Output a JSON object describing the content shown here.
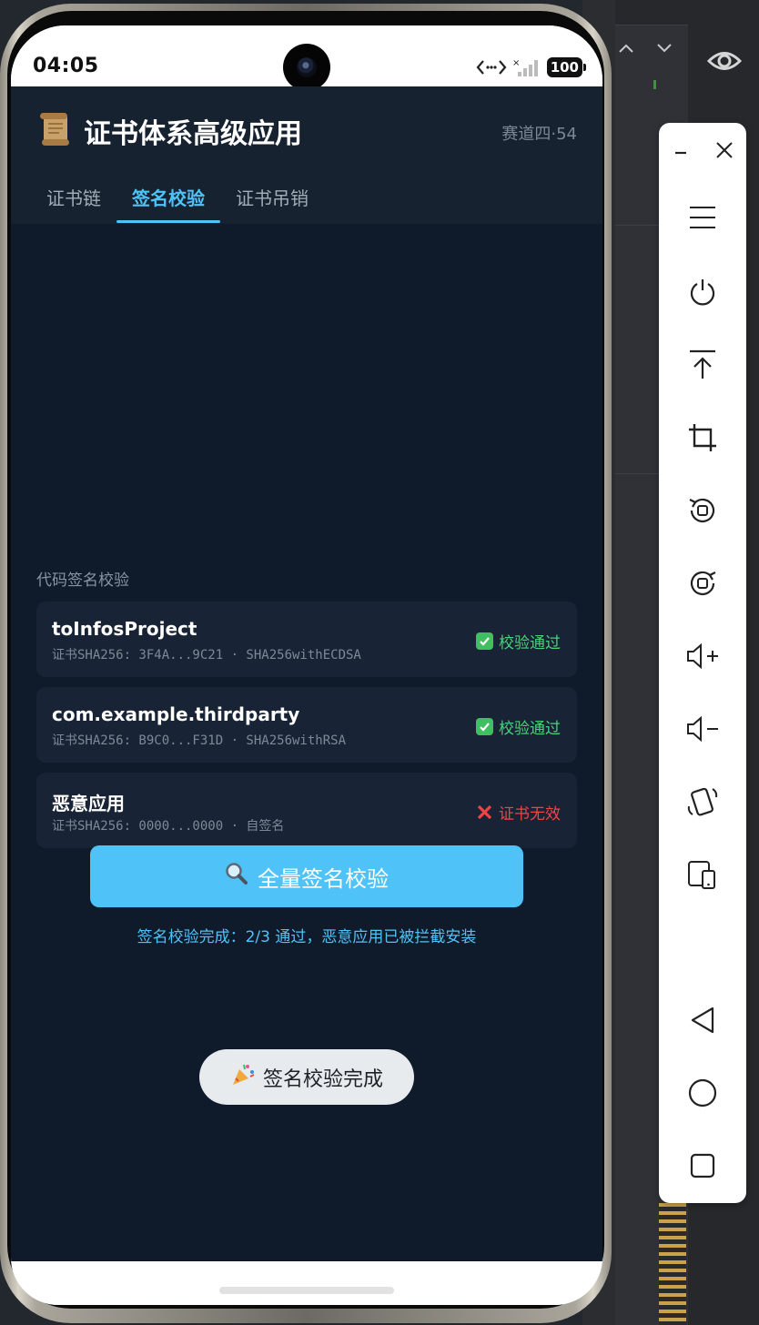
{
  "status_bar": {
    "time": "04:05",
    "battery": "100"
  },
  "app": {
    "icon": "scroll-icon",
    "title": "证书体系高级应用",
    "track_label": "赛道四·54",
    "tabs": [
      {
        "label": "证书链",
        "active": false
      },
      {
        "label": "签名校验",
        "active": true
      },
      {
        "label": "证书吊销",
        "active": false
      }
    ],
    "section_title": "代码签名校验",
    "apps": [
      {
        "name": "toInfosProject",
        "meta": "证书SHA256: 3F4A...9C21 · SHA256withECDSA",
        "status": "校验通过",
        "status_type": "pass"
      },
      {
        "name": "com.example.thirdparty",
        "meta": "证书SHA256: B9C0...F31D · SHA256withRSA",
        "status": "校验通过",
        "status_type": "pass"
      },
      {
        "name": "恶意应用",
        "meta": "证书SHA256: 0000...0000 · 自签名",
        "status": "证书无效",
        "status_type": "fail"
      }
    ],
    "verify_button": {
      "icon": "magnifier-icon",
      "label": "全量签名校验"
    },
    "result": "签名校验完成：2/3 通过，恶意应用已被拦截安装",
    "toast": {
      "icon": "party-popper-icon",
      "label": "签名校验完成"
    }
  },
  "colors": {
    "accent": "#4fc3f7",
    "pass": "#4cd07d",
    "fail": "#ef4444",
    "background": "#0f1b2b",
    "card": "#182435"
  },
  "emulator_toolbar": {
    "buttons": [
      "minimize-icon",
      "close-icon",
      "menu-icon",
      "power-icon",
      "upload-icon",
      "crop-icon",
      "rotate-left-icon",
      "rotate-right-icon",
      "volume-up-icon",
      "volume-down-icon",
      "shake-icon",
      "device-icon",
      "back-icon",
      "home-icon",
      "recents-icon"
    ]
  }
}
